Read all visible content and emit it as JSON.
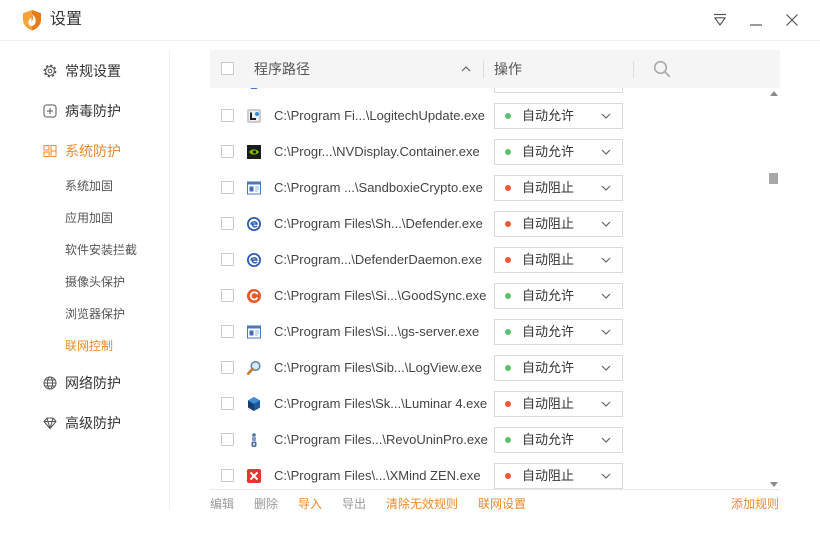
{
  "window": {
    "title": "设置",
    "logo_icon": "huorong-logo-icon"
  },
  "colors": {
    "accent": "#ec8a2c",
    "allow": "#5cbf6b",
    "block": "#f0563a"
  },
  "sidebar": {
    "items": [
      {
        "label": "常规设置",
        "icon": "gear-icon",
        "active": false
      },
      {
        "label": "病毒防护",
        "icon": "plus-square-icon",
        "active": false
      },
      {
        "label": "系统防护",
        "icon": "system-protect-icon",
        "active": true
      },
      {
        "label": "网络防护",
        "icon": "globe-icon",
        "active": false
      },
      {
        "label": "高级防护",
        "icon": "diamond-icon",
        "active": false
      }
    ],
    "sub_items": [
      {
        "label": "系统加固",
        "active": false
      },
      {
        "label": "应用加固",
        "active": false
      },
      {
        "label": "软件安装拦截",
        "active": false
      },
      {
        "label": "摄像头保护",
        "active": false
      },
      {
        "label": "浏览器保护",
        "active": false
      },
      {
        "label": "联网控制",
        "active": true
      }
    ]
  },
  "table": {
    "path_header": "程序路径",
    "action_header": "操作",
    "scroll_position": 0.2,
    "rows": [
      {
        "icon": "logitech-update-icon",
        "path": "C:\\Program Fi...\\LogitechUpdate.exe",
        "action": "自动允许",
        "dot_color": "#5cbf6b"
      },
      {
        "icon": "nvidia-icon",
        "path": "C:\\Progr...\\NVDisplay.Container.exe",
        "action": "自动允许",
        "dot_color": "#5cbf6b"
      },
      {
        "icon": "sandboxie-crypto-icon",
        "path": "C:\\Program ...\\SandboxieCrypto.exe",
        "action": "自动阻止",
        "dot_color": "#f0563a"
      },
      {
        "icon": "defender-icon",
        "path": "C:\\Program Files\\Sh...\\Defender.exe",
        "action": "自动阻止",
        "dot_color": "#f0563a"
      },
      {
        "icon": "defender-daemon-icon",
        "path": "C:\\Program...\\DefenderDaemon.exe",
        "action": "自动阻止",
        "dot_color": "#f0563a"
      },
      {
        "icon": "goodsync-icon",
        "path": "C:\\Program Files\\Si...\\GoodSync.exe",
        "action": "自动允许",
        "dot_color": "#5cbf6b"
      },
      {
        "icon": "gs-server-icon",
        "path": "C:\\Program Files\\Si...\\gs-server.exe",
        "action": "自动允许",
        "dot_color": "#5cbf6b"
      },
      {
        "icon": "logview-icon",
        "path": "C:\\Program Files\\Sib...\\LogView.exe",
        "action": "自动允许",
        "dot_color": "#5cbf6b"
      },
      {
        "icon": "luminar-icon",
        "path": "C:\\Program Files\\Sk...\\Luminar 4.exe",
        "action": "自动阻止",
        "dot_color": "#f0563a"
      },
      {
        "icon": "revo-uninstaller-icon",
        "path": "C:\\Program Files...\\RevoUninPro.exe",
        "action": "自动允许",
        "dot_color": "#5cbf6b"
      },
      {
        "icon": "xmind-icon",
        "path": "C:\\Program Files\\...\\XMind ZEN.exe",
        "action": "自动阻止",
        "dot_color": "#f0563a"
      }
    ]
  },
  "toolbar": {
    "edit": {
      "label": "编辑",
      "enabled": false
    },
    "delete": {
      "label": "删除",
      "enabled": false
    },
    "import": {
      "label": "导入",
      "enabled": true
    },
    "export": {
      "label": "导出",
      "enabled": false
    },
    "clear_invalid": {
      "label": "清除无效规则",
      "enabled": true
    },
    "network_settings": {
      "label": "联网设置",
      "enabled": true
    },
    "add_rule": {
      "label": "添加规则",
      "enabled": true
    }
  }
}
